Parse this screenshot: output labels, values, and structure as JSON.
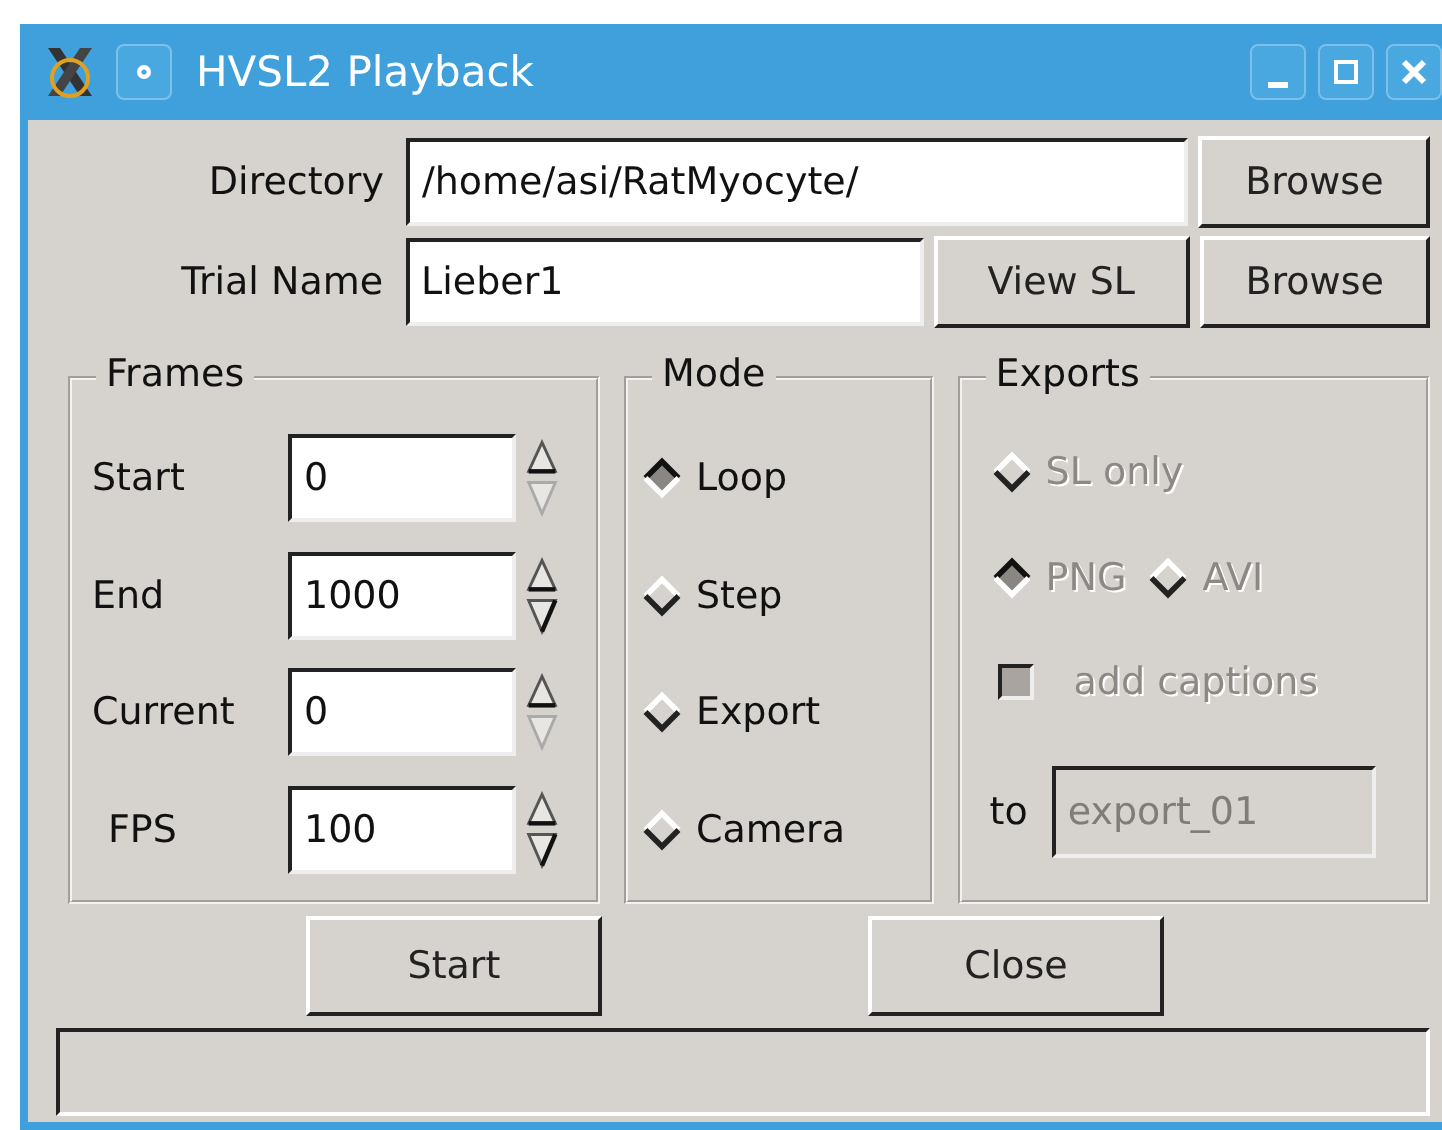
{
  "window": {
    "title": "HVSL2 Playback"
  },
  "directory": {
    "label": "Directory",
    "value": "/home/asi/RatMyocyte/",
    "browse": "Browse"
  },
  "trial": {
    "label": "Trial Name",
    "value": "Lieber1",
    "view": "View SL",
    "browse": "Browse"
  },
  "frames": {
    "title": "Frames",
    "fields": [
      {
        "label": "Start",
        "value": "0",
        "down_disabled": true
      },
      {
        "label": "End",
        "value": "1000",
        "down_disabled": false
      },
      {
        "label": "Current",
        "value": "0",
        "down_disabled": true
      },
      {
        "label": "FPS",
        "value": "100",
        "down_disabled": false
      }
    ]
  },
  "mode": {
    "title": "Mode",
    "options": [
      {
        "label": "Loop",
        "selected": true
      },
      {
        "label": "Step",
        "selected": false
      },
      {
        "label": "Export",
        "selected": false
      },
      {
        "label": "Camera",
        "selected": false
      }
    ]
  },
  "exports": {
    "title": "Exports",
    "disabled": true,
    "options": [
      {
        "label": "SL only",
        "selected": false
      },
      {
        "label": "PNG",
        "selected": true
      },
      {
        "label": "AVI",
        "selected": false
      }
    ],
    "captions": {
      "label": "add captions",
      "checked": false
    },
    "to": {
      "label": "to",
      "value": "export_01"
    }
  },
  "buttons": [
    "Start",
    "Close"
  ]
}
